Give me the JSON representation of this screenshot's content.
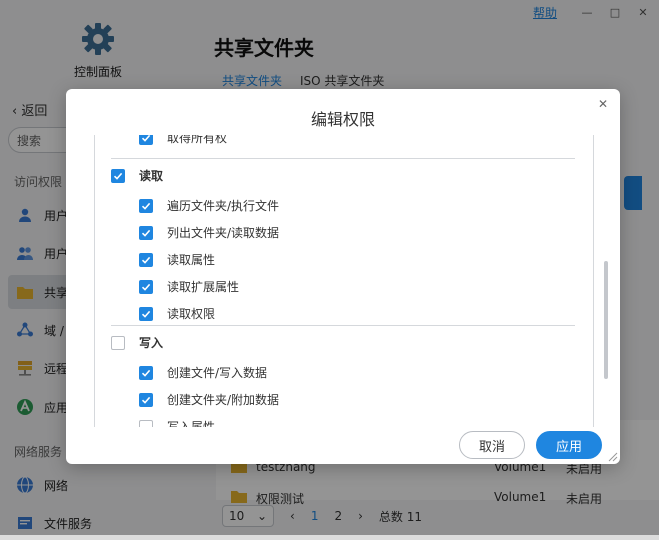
{
  "window": {
    "help_link": "帮助"
  },
  "control_panel": {
    "label": "控制面板",
    "icon": "gear-icon"
  },
  "page": {
    "title": "共享文件夹",
    "tabs": [
      {
        "label": "共享文件夹",
        "active": true
      },
      {
        "label": "ISO 共享文件夹",
        "active": false
      }
    ]
  },
  "sidebar": {
    "back_label": "返回",
    "search_placeholder": "搜索",
    "section_access": "访问权限",
    "section_network": "网络服务",
    "items": [
      {
        "label": "用户",
        "icon": "user-icon"
      },
      {
        "label": "用户",
        "icon": "user-group-icon"
      },
      {
        "label": "共享",
        "icon": "folder-icon",
        "active": true
      },
      {
        "label": "域 /",
        "icon": "domain-icon"
      },
      {
        "label": "远程",
        "icon": "remote-icon"
      },
      {
        "label": "应用",
        "icon": "app-icon"
      },
      {
        "label": "网络",
        "icon": "network-icon"
      },
      {
        "label": "文件服务",
        "icon": "file-service-icon"
      }
    ]
  },
  "table": {
    "rows": [
      {
        "name": "testzhang",
        "volume": "Volume1",
        "status": "未启用"
      },
      {
        "name": "权限测试",
        "volume": "Volume1",
        "status": "未启用"
      }
    ]
  },
  "pager": {
    "per_page": "10",
    "pages": [
      "1",
      "2"
    ],
    "total_label": "总数",
    "total": "11"
  },
  "modal": {
    "title": "编辑权限",
    "permissions": [
      {
        "label": "取得所有权",
        "level": "sub",
        "checked": true
      },
      {
        "label": "读取",
        "level": "group",
        "checked": true
      },
      {
        "label": "遍历文件夹/执行文件",
        "level": "sub",
        "checked": true
      },
      {
        "label": "列出文件夹/读取数据",
        "level": "sub",
        "checked": true
      },
      {
        "label": "读取属性",
        "level": "sub",
        "checked": true
      },
      {
        "label": "读取扩展属性",
        "level": "sub",
        "checked": true
      },
      {
        "label": "读取权限",
        "level": "sub",
        "checked": true
      },
      {
        "label": "写入",
        "level": "group",
        "checked": false
      },
      {
        "label": "创建文件/写入数据",
        "level": "sub",
        "checked": true
      },
      {
        "label": "创建文件夹/附加数据",
        "level": "sub",
        "checked": true
      },
      {
        "label": "写入属性",
        "level": "sub",
        "checked": false
      }
    ],
    "cancel_label": "取消",
    "apply_label": "应用"
  },
  "colors": {
    "accent": "#1f86e0"
  }
}
